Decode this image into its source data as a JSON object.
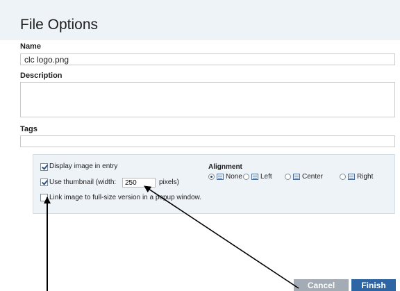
{
  "dialog": {
    "title": "File Options",
    "name": {
      "label": "Name",
      "value": "clc logo.png"
    },
    "description": {
      "label": "Description",
      "value": ""
    },
    "tags": {
      "label": "Tags",
      "value": ""
    }
  },
  "options": {
    "display_image": {
      "label": "Display image in entry",
      "checked": true
    },
    "use_thumbnail": {
      "label_prefix": "Use thumbnail (width:",
      "width_value": "250",
      "label_suffix": "pixels)",
      "checked": true
    },
    "link_image": {
      "label": "Link image to full-size version in a popup window."
    },
    "alignment": {
      "label": "Alignment",
      "options": [
        "None",
        "Left",
        "Center",
        "Right"
      ],
      "selected": "None"
    }
  },
  "buttons": {
    "cancel": "Cancel",
    "finish": "Finish"
  }
}
